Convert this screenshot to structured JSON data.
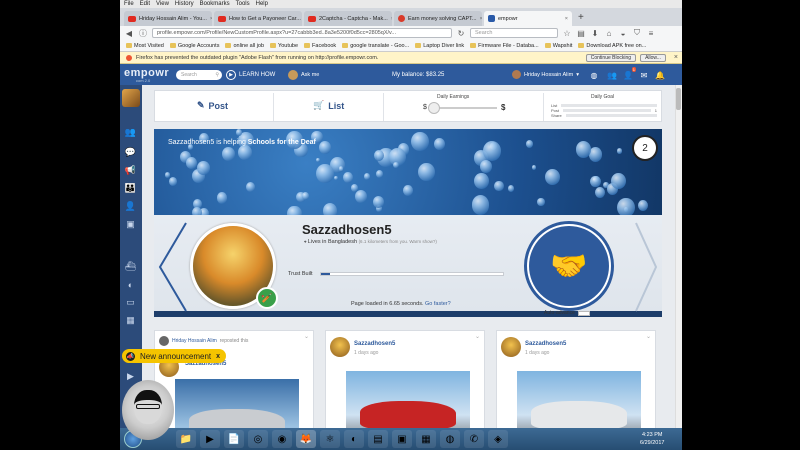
{
  "browser": {
    "menu": [
      "File",
      "Edit",
      "View",
      "History",
      "Bookmarks",
      "Tools",
      "Help"
    ],
    "tabs": [
      {
        "title": "Hriday Hossain Alim - You...",
        "icon": "youtube-icon"
      },
      {
        "title": "How to Get a Payoneer Car...",
        "icon": "youtube-icon"
      },
      {
        "title": "2Captcha - Captcha - Mak...",
        "icon": "youtube-icon"
      },
      {
        "title": "Earn money solving CAPT...",
        "icon": "captcha-icon"
      },
      {
        "title": "empowr",
        "icon": "empowr-icon"
      }
    ],
    "url": "profile.empowr.com/Profile/NewCustomProfile.aspx?u=27cabbb3ed..8a3e5200f0d5cc=2805qX/v...",
    "search_placeholder": "Search",
    "bookmarks": [
      "Most Visited",
      "Google Accounts",
      "online all job",
      "Youtube",
      "Facebook",
      "google translate - Goo...",
      "Laptop Diver link",
      "Firmware File - Databa...",
      "Wapshit",
      "Download APK free on..."
    ],
    "notice": "Firefox has prevented the outdated plugin \"Adobe Flash\" from running on http://profile.empowr.com.",
    "notice_buttons": [
      "Continue Blocking",
      "Allow..."
    ]
  },
  "site": {
    "logo": "empowr",
    "logo_sub": "com 2.0",
    "search_placeholder": "Search",
    "learn_how": "LEARN HOW",
    "ask_me": "Ask me",
    "balance": "My balance: $83.25",
    "username": "Hriday Hossain Alim",
    "notif_count": "1"
  },
  "toolbar": {
    "post": "Post",
    "list": "List",
    "earnings_label": "Daily Earnings",
    "earnings_min": "$",
    "earnings_max": "$",
    "earnings_level": 0.05,
    "goal_label": "Daily Goal",
    "goals": [
      {
        "label": "List",
        "value": ""
      },
      {
        "label": "Post",
        "value": "1"
      },
      {
        "label": "Share",
        "value": ""
      }
    ]
  },
  "banner": {
    "helper": "Sazzadhosen5",
    "helping_text": " is helping ",
    "cause": "Schools for the Deaf",
    "number": "2"
  },
  "profile": {
    "name": "Sazzadhosen5",
    "lives": "Lives in Bangladesh",
    "lives_meta": "(6.1 kilometers from you. Warm show?)",
    "trust_label": "Trust Built",
    "trust_level": 0.05,
    "loaded_text": "Page loaded in 6.65 seconds.",
    "loaded_link": "Go faster?",
    "auto_advance": "Auto-advance"
  },
  "feed": {
    "card1_reposter": "Hriday Hossain Alim",
    "card1_reposted": "reposted this",
    "card1_author": "Sazzadhosen5",
    "card2_author": "Sazzadhosen5",
    "card2_ago": "1 days ago",
    "card3_author": "Sazzadhosen5",
    "card3_ago": "1 days ago"
  },
  "announcement": "New announcement",
  "taskbar": {
    "time": "4:23 PM",
    "date": "6/29/2017"
  }
}
